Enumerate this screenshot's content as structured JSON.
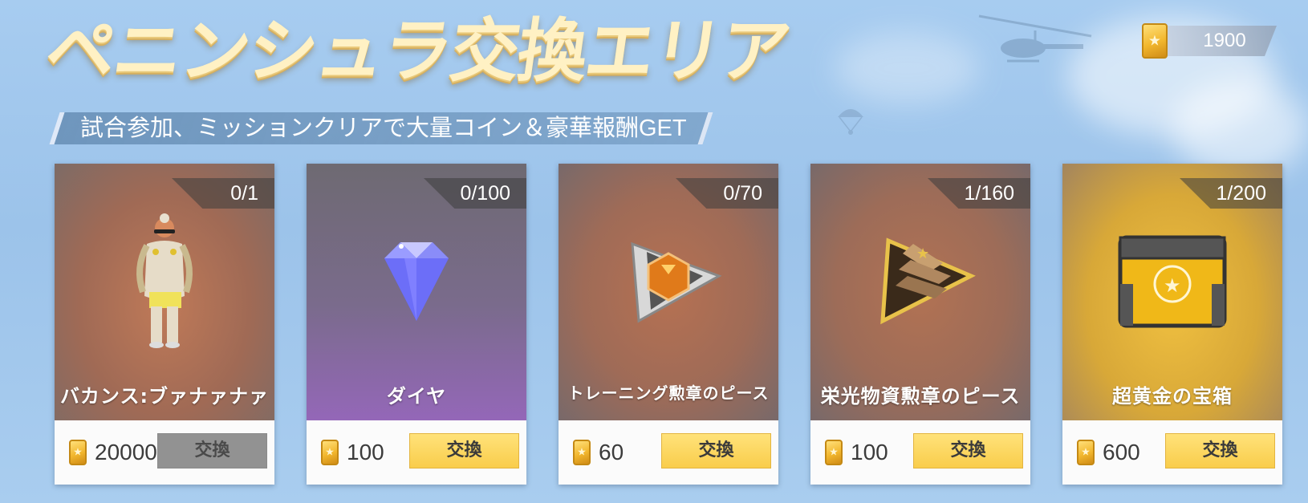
{
  "header": {
    "title": "ペニンシュラ交換エリア",
    "subtitle": "試合参加、ミッションクリアで大量コイン＆豪華報酬GET"
  },
  "currency": {
    "amount": "1900",
    "icon": "token-coin-icon"
  },
  "colors": {
    "button_yellow": "#f9cd4b",
    "button_disabled": "#808080",
    "title_cream": "#fff1c4"
  },
  "items": [
    {
      "counter": "0/1",
      "name": "バカンス:ブァナァナァ",
      "price": "20000",
      "button": "交換",
      "button_disabled": true,
      "icon": "character-outfit-icon"
    },
    {
      "counter": "0/100",
      "name": "ダイヤ",
      "price": "100",
      "button": "交換",
      "button_disabled": false,
      "icon": "diamond-icon"
    },
    {
      "counter": "0/70",
      "name": "トレーニング勲章のピース",
      "price": "60",
      "button": "交換",
      "button_disabled": false,
      "icon": "training-medal-piece-icon"
    },
    {
      "counter": "1/160",
      "name": "栄光物資勲章のピース",
      "price": "100",
      "button": "交換",
      "button_disabled": false,
      "icon": "glory-medal-piece-icon"
    },
    {
      "counter": "1/200",
      "name": "超黄金の宝箱",
      "price": "600",
      "button": "交換",
      "button_disabled": false,
      "icon": "golden-treasure-chest-icon"
    }
  ]
}
